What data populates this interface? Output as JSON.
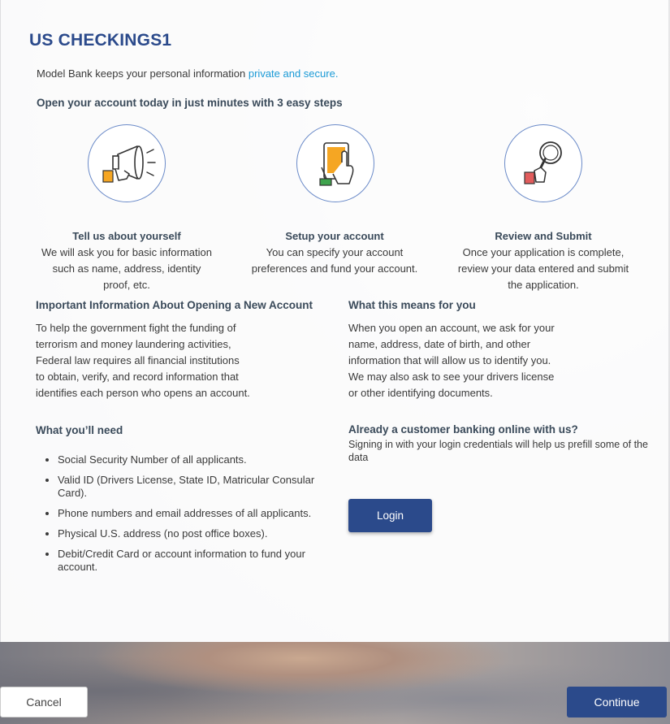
{
  "page": {
    "title": "US CHECKINGS1",
    "privacy_prefix": "Model Bank keeps your personal information ",
    "privacy_link": "private and secure.",
    "steps_heading": "Open your account today in just minutes with 3 easy steps"
  },
  "steps": [
    {
      "icon": "megaphone-icon",
      "title": "Tell us about yourself",
      "text": "We will ask you for basic information such as name, address, identity proof, etc."
    },
    {
      "icon": "tablet-tap-icon",
      "title": "Setup your account",
      "text": "You can specify your account preferences and fund your account."
    },
    {
      "icon": "magnifier-icon",
      "title": "Review and Submit",
      "text": "Once your application is complete, review your data entered and submit the application."
    }
  ],
  "important": {
    "title": "Important Information About Opening a New Account",
    "text": "To help the government fight the funding of terrorism and money laundering activities, Federal law requires all financial institutions to obtain, verify, and record information that identifies each person who opens an account."
  },
  "means": {
    "title": "What this means for you",
    "text": "When you open an account, we ask for your name, address, date of birth, and other information that will allow us to identify you. We may also ask to see your drivers license or other identifying documents."
  },
  "needs": {
    "title": "What you’ll need",
    "items": [
      "Social Security Number of all applicants.",
      "Valid ID (Drivers License, State ID, Matricular Consular Card).",
      "Phone numbers and email addresses of all applicants.",
      "Physical U.S. address (no post office boxes).",
      "Debit/Credit Card or account information to fund your account."
    ]
  },
  "existing": {
    "title": "Already a customer banking online with us?",
    "text": "Signing in with your login credentials will help us prefill some of the data",
    "login_label": "Login"
  },
  "footer": {
    "cancel_label": "Cancel",
    "continue_label": "Continue"
  },
  "colors": {
    "primary": "#2b4a8b",
    "link": "#1a9ad6",
    "icon_orange": "#f5a623",
    "icon_red": "#e25c5c",
    "icon_green": "#3fa34d"
  }
}
